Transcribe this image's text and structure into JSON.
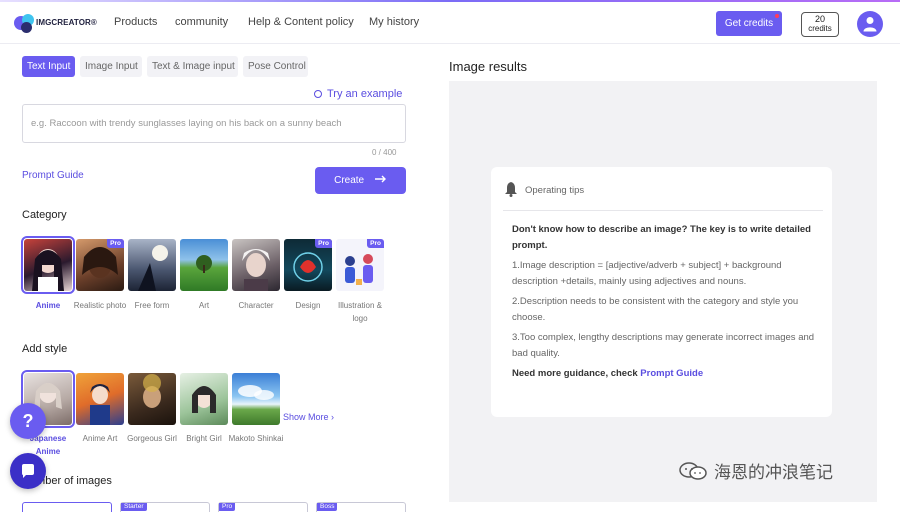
{
  "header": {
    "logo_text": "IMGCREATOR®",
    "nav": [
      "Products",
      "community",
      "Help & Content policy",
      "My history"
    ],
    "get_credits_label": "Get credits",
    "credits_count": "20",
    "credits_label": "credits"
  },
  "input_tabs": [
    "Text Input",
    "Image Input",
    "Text & Image input",
    "Pose Control"
  ],
  "try_example": "Try an example",
  "prompt": {
    "placeholder": "e.g. Raccoon with trendy sunglasses laying on his back on a sunny beach",
    "counter": "0 / 400"
  },
  "prompt_guide": "Prompt Guide",
  "create_label": "Create",
  "category": {
    "title": "Category",
    "items": [
      {
        "label": "Anime",
        "pro": false,
        "selected": true
      },
      {
        "label": "Realistic photo",
        "pro": true,
        "selected": false
      },
      {
        "label": "Free form",
        "pro": false,
        "selected": false
      },
      {
        "label": "Art",
        "pro": false,
        "selected": false
      },
      {
        "label": "Character",
        "pro": false,
        "selected": false
      },
      {
        "label": "Design",
        "pro": true,
        "selected": false
      },
      {
        "label": "Illustration & logo",
        "pro": true,
        "selected": false
      }
    ],
    "pro_badge": "Pro"
  },
  "style": {
    "title": "Add style",
    "items": [
      "Japanese Anime",
      "Anime Art",
      "Gorgeous Girl",
      "Bright Girl",
      "Makoto Shinkai"
    ],
    "show_more": "Show More"
  },
  "images": {
    "title": "Number of images",
    "tags": [
      "Starter",
      "Pro",
      "Boss"
    ]
  },
  "help_label": "?",
  "results": {
    "title": "Image results",
    "tips_header": "Operating tips",
    "lead": "Don't know how to describe an image? The key is to write detailed prompt.",
    "tip1": "1.Image description = [adjective/adverb + subject] + background description +details, mainly using adjectives and nouns.",
    "tip2": "2.Description needs to be consistent with the category and style you choose.",
    "tip3": "3.Too complex, lengthy descriptions may generate incorrect images and bad quality.",
    "more_prefix": "Need more guidance, check ",
    "more_link": "Prompt Guide"
  },
  "watermark": "海恩的冲浪笔记",
  "colors": {
    "accent": "#6a5cf0",
    "panel_bg": "#f2f2f4"
  }
}
